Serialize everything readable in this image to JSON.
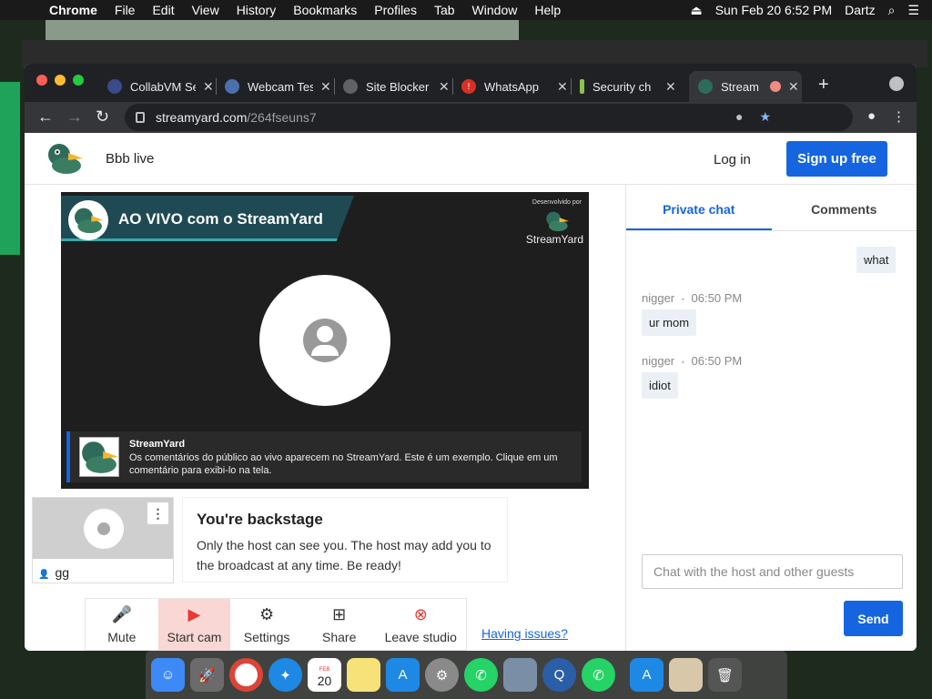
{
  "menubar": {
    "app": "Chrome",
    "items": [
      "File",
      "Edit",
      "View",
      "History",
      "Bookmarks",
      "Profiles",
      "Tab",
      "Window",
      "Help"
    ],
    "datetime": "Sun Feb 20  6:52 PM",
    "user": "Dartz"
  },
  "browser": {
    "tabs": [
      {
        "title": "CollabVM Se"
      },
      {
        "title": "Webcam Tes"
      },
      {
        "title": "Site Blocker"
      },
      {
        "title": "WhatsApp"
      },
      {
        "title": "Security ch"
      },
      {
        "title": "Stream"
      }
    ],
    "url_host": "streamyard.com",
    "url_path": "/264fseuns7"
  },
  "header": {
    "studio_name": "Bbb live",
    "login_label": "Log in",
    "signup_label": "Sign up free"
  },
  "stage": {
    "banner_text": "AO VIVO com o StreamYard",
    "brand_small": "Desenvolvido por",
    "brand_name": "StreamYard",
    "comment_name": "StreamYard",
    "comment_text": "Os comentários do público ao vivo aparecem no StreamYard. Este é um exemplo. Clique em um comentário para exibi-lo na tela."
  },
  "self_tile": {
    "name": "gg",
    "menu_glyph": "⋮"
  },
  "backstage": {
    "title": "You're backstage",
    "text": "Only the host can see you. The host may add you to the broadcast at any time. Be ready!"
  },
  "controls": {
    "mute": "Mute",
    "start_cam": "Start cam",
    "settings": "Settings",
    "share": "Share",
    "leave": "Leave studio",
    "issues": "Having issues?"
  },
  "chat": {
    "tab_private": "Private chat",
    "tab_comments": "Comments",
    "messages": [
      {
        "text": "what"
      },
      {
        "author": "nigger",
        "time": "06:50 PM",
        "text": "ur mom"
      },
      {
        "author": "nigger",
        "time": "06:50 PM",
        "text": "idiot"
      }
    ],
    "dot": "•",
    "placeholder": "Chat with the host and other guests",
    "send_label": "Send"
  },
  "dock": {
    "calendar_month": "FEB",
    "calendar_day": "20"
  },
  "colors": {
    "accent": "#1565e0",
    "chat_bubble": "#eaf0f5",
    "cam_off": "#f8d7d4",
    "leave_red": "#e53935"
  }
}
